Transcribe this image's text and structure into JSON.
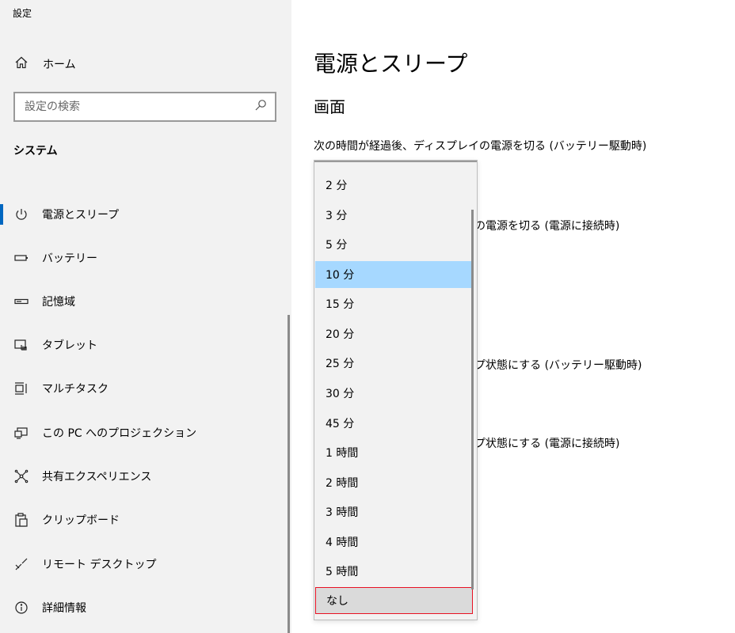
{
  "app": {
    "title": "設定"
  },
  "sidebar": {
    "home_label": "ホーム",
    "search_placeholder": "設定の検索",
    "section_title": "システム",
    "items": [
      {
        "label": "電源とスリープ",
        "icon": "power-icon",
        "active": true
      },
      {
        "label": "バッテリー",
        "icon": "battery-icon"
      },
      {
        "label": "記憶域",
        "icon": "storage-icon"
      },
      {
        "label": "タブレット",
        "icon": "tablet-icon"
      },
      {
        "label": "マルチタスク",
        "icon": "multitask-icon"
      },
      {
        "label": "この PC へのプロジェクション",
        "icon": "projection-icon"
      },
      {
        "label": "共有エクスペリエンス",
        "icon": "shared-experience-icon"
      },
      {
        "label": "クリップボード",
        "icon": "clipboard-icon"
      },
      {
        "label": "リモート デスクトップ",
        "icon": "remote-desktop-icon"
      },
      {
        "label": "詳細情報",
        "icon": "info-icon"
      }
    ]
  },
  "main": {
    "title": "電源とスリープ",
    "section": "画面",
    "setting1_label": "次の時間が経過後、ディスプレイの電源を切る (バッテリー駆動時)",
    "setting2_partial": "の電源を切る (電源に接続時)",
    "setting3_partial": "プ状態にする (バッテリー駆動時)",
    "setting4_partial": "プ状態にする (電源に接続時)"
  },
  "dropdown": {
    "options": [
      "2 分",
      "3 分",
      "5 分",
      "10 分",
      "15 分",
      "20 分",
      "25 分",
      "30 分",
      "45 分",
      "1 時間",
      "2 時間",
      "3 時間",
      "4 時間",
      "5 時間",
      "なし"
    ],
    "selected": "10 分",
    "highlighted": "なし"
  },
  "colors": {
    "accent": "#0067c0",
    "selected_bg": "#a6d8ff",
    "highlight_border": "#e81123",
    "sidebar_bg": "#f2f2f2"
  }
}
